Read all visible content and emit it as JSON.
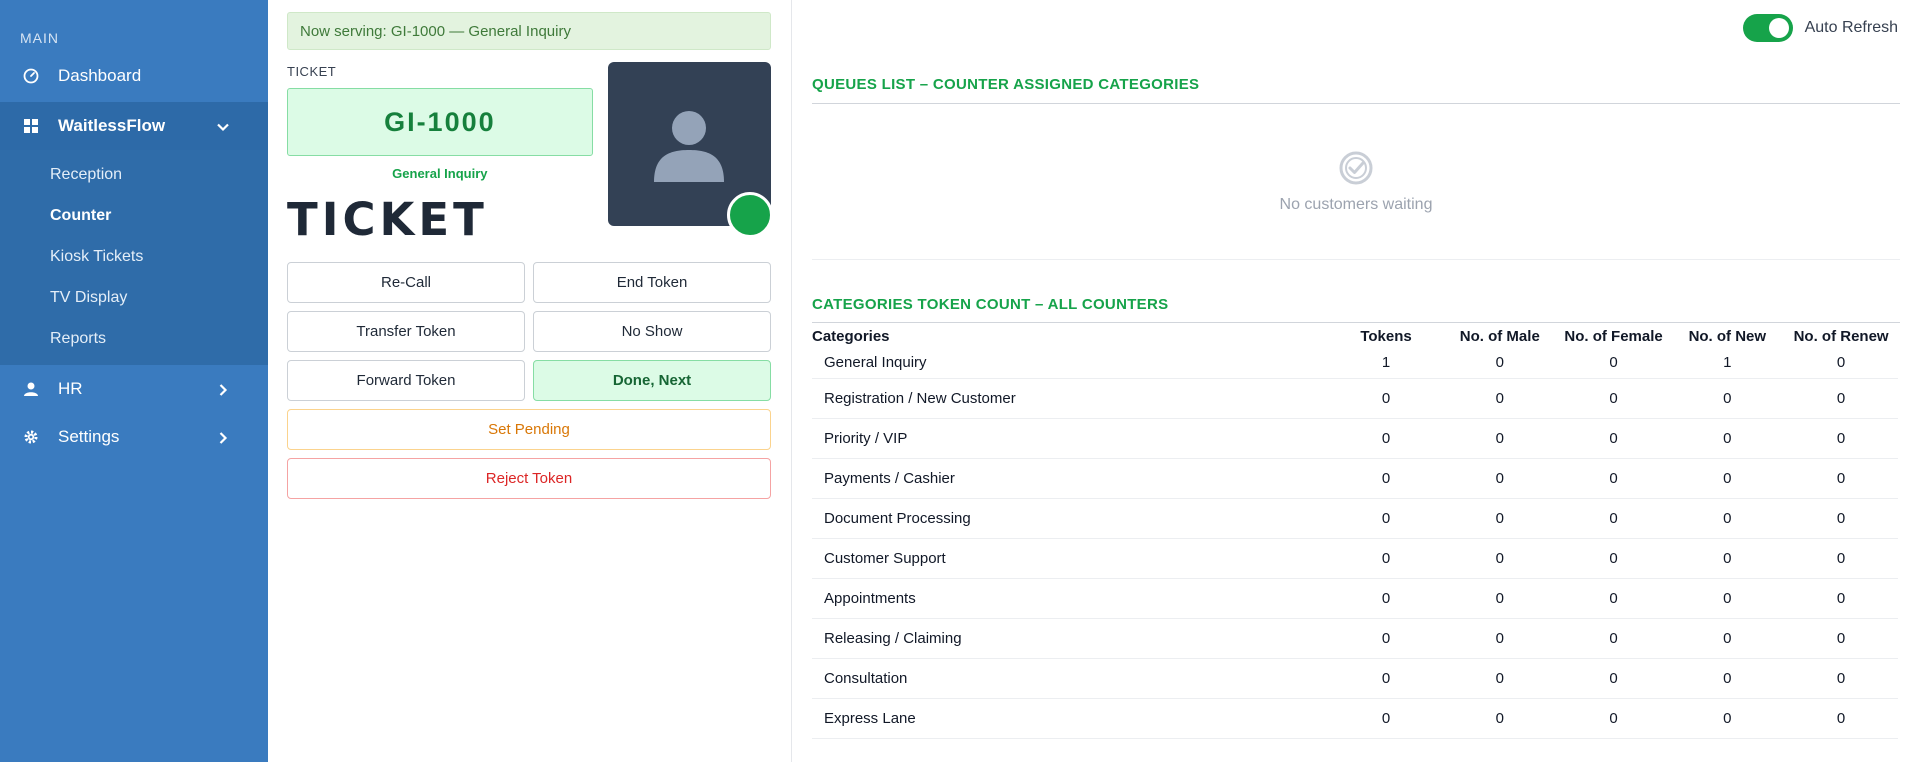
{
  "sidebar": {
    "section_label": "MAIN",
    "dashboard": "Dashboard",
    "app_name": "WaitlessFlow",
    "sub_items": [
      "Reception",
      "Counter",
      "Kiosk Tickets",
      "TV Display",
      "Reports"
    ],
    "current_sub": "Counter",
    "hr": "HR",
    "settings": "Settings"
  },
  "serving": {
    "text": "Now serving: GI-1000 — General Inquiry"
  },
  "ticket": {
    "caption": "TICKET",
    "number": "GI-1000",
    "category": "General Inquiry",
    "big_label": "TICKET",
    "status_color": "#16a34a"
  },
  "actions": {
    "recall": "Re-Call",
    "end_token": "End Token",
    "transfer": "Transfer Token",
    "no_show": "No Show",
    "forward": "Forward Token",
    "done_next": "Done, Next",
    "set_pending": "Set Pending",
    "reject": "Reject Token"
  },
  "auto_refresh": {
    "label": "Auto Refresh",
    "on": true
  },
  "queues": {
    "title": "QUEUES LIST – COUNTER ASSIGNED CATEGORIES",
    "empty_text": "No customers waiting"
  },
  "counts": {
    "title": "CATEGORIES TOKEN COUNT – ALL COUNTERS",
    "headers": [
      "Categories",
      "Tokens",
      "No. of Male",
      "No. of Female",
      "No. of New",
      "No. of Renew"
    ],
    "rows": [
      [
        "General Inquiry",
        "1",
        "0",
        "0",
        "1",
        "0"
      ],
      [
        "Registration / New Customer",
        "0",
        "0",
        "0",
        "0",
        "0"
      ],
      [
        "Priority / VIP",
        "0",
        "0",
        "0",
        "0",
        "0"
      ],
      [
        "Payments / Cashier",
        "0",
        "0",
        "0",
        "0",
        "0"
      ],
      [
        "Document Processing",
        "0",
        "0",
        "0",
        "0",
        "0"
      ],
      [
        "Customer Support",
        "0",
        "0",
        "0",
        "0",
        "0"
      ],
      [
        "Appointments",
        "0",
        "0",
        "0",
        "0",
        "0"
      ],
      [
        "Releasing / Claiming",
        "0",
        "0",
        "0",
        "0",
        "0"
      ],
      [
        "Consultation",
        "0",
        "0",
        "0",
        "0",
        "0"
      ],
      [
        "Express Lane",
        "0",
        "0",
        "0",
        "0",
        "0"
      ]
    ]
  },
  "colors": {
    "sidebar_bg": "#3a7bbf",
    "accent_green": "#16a34a",
    "danger": "#dc2626",
    "warning": "#d97706"
  }
}
